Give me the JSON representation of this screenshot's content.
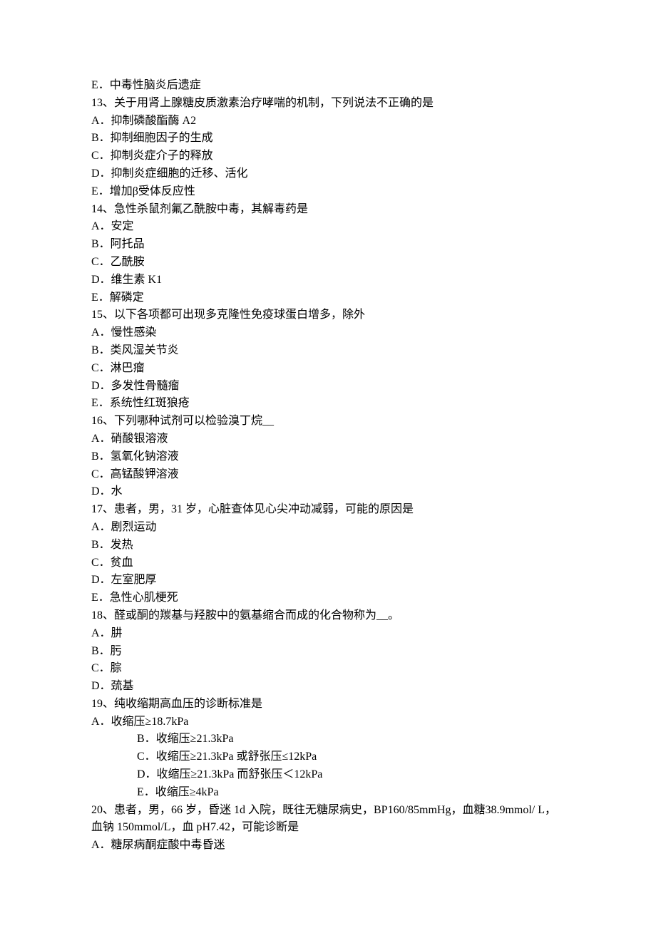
{
  "lines": [
    {
      "text": "E．中毒性脑炎后遗症",
      "indent": false
    },
    {
      "text": "13、关于用肾上腺糖皮质激素治疗哮喘的机制，下列说法不正确的是",
      "indent": false
    },
    {
      "text": "A．抑制磷酸酯酶 A2",
      "indent": false
    },
    {
      "text": "B．抑制细胞因子的生成",
      "indent": false
    },
    {
      "text": "C．抑制炎症介子的释放",
      "indent": false
    },
    {
      "text": "D．抑制炎症细胞的迁移、活化",
      "indent": false
    },
    {
      "text": "E．增加β受体反应性",
      "indent": false
    },
    {
      "text": "14、急性杀鼠剂氟乙酰胺中毒，其解毒药是",
      "indent": false
    },
    {
      "text": "A．安定",
      "indent": false
    },
    {
      "text": "B．阿托品",
      "indent": false
    },
    {
      "text": "C．乙酰胺",
      "indent": false
    },
    {
      "text": "D．维生素 K1",
      "indent": false
    },
    {
      "text": "E．解磷定",
      "indent": false
    },
    {
      "text": "15、以下各项都可出现多克隆性免疫球蛋白增多，除外",
      "indent": false
    },
    {
      "text": "A．慢性感染",
      "indent": false
    },
    {
      "text": "B．类风湿关节炎",
      "indent": false
    },
    {
      "text": "C．淋巴瘤",
      "indent": false
    },
    {
      "text": "D．多发性骨髓瘤",
      "indent": false
    },
    {
      "text": "E．系统性红斑狼疮",
      "indent": false
    },
    {
      "text": "16、下列哪种试剂可以检验溴丁烷__",
      "indent": false
    },
    {
      "text": "A．硝酸银溶液",
      "indent": false
    },
    {
      "text": "B．氢氧化钠溶液",
      "indent": false
    },
    {
      "text": "C．高锰酸钾溶液",
      "indent": false
    },
    {
      "text": "D．水",
      "indent": false
    },
    {
      "text": "17、患者，男，31 岁，心脏查体见心尖冲动减弱，可能的原因是",
      "indent": false
    },
    {
      "text": "A．剧烈运动",
      "indent": false
    },
    {
      "text": "B．发热",
      "indent": false
    },
    {
      "text": "C．贫血",
      "indent": false
    },
    {
      "text": "D．左室肥厚",
      "indent": false
    },
    {
      "text": "E．急性心肌梗死",
      "indent": false
    },
    {
      "text": "18、醛或酮的羰基与羟胺中的氨基缩合而成的化合物称为__。",
      "indent": false
    },
    {
      "text": "A．肼",
      "indent": false
    },
    {
      "text": "B．肟",
      "indent": false
    },
    {
      "text": "C．腙",
      "indent": false
    },
    {
      "text": "D．巯基",
      "indent": false
    },
    {
      "text": "19、纯收缩期高血压的诊断标准是",
      "indent": false
    },
    {
      "text": "A．收缩压≥18.7kPa",
      "indent": false
    },
    {
      "text": "B．收缩压≥21.3kPa",
      "indent": true
    },
    {
      "text": "C．收缩压≥21.3kPa 或舒张压≤12kPa",
      "indent": true
    },
    {
      "text": "D．收缩压≥21.3kPa 而舒张压＜12kPa",
      "indent": true
    },
    {
      "text": "E．收缩压≥4kPa",
      "indent": true
    },
    {
      "text": "20、患者，男，66 岁，昏迷 1d 入院，既往无糖尿病史，BP160/85mmHg，血糖38.9mmol/ L，血钠 150mmol/L，血 pH7.42，可能诊断是",
      "indent": false
    },
    {
      "text": "A．糖尿病酮症酸中毒昏迷",
      "indent": false
    }
  ]
}
